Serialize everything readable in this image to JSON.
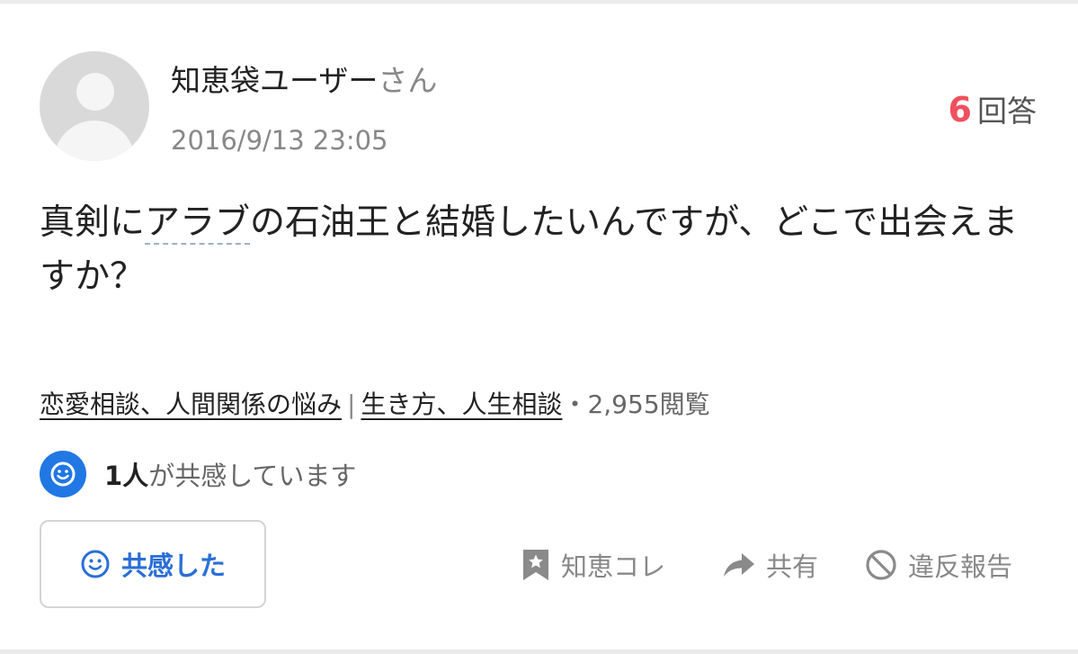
{
  "question": {
    "user_name": "知恵袋ユーザー",
    "user_suffix": "さん",
    "posted_at": "2016/9/13 23:05",
    "answer_count": "6",
    "answer_label": "回答",
    "text_before": "真剣に",
    "text_keyword": "アラブ",
    "text_after": "の石油王と結婚したいんですが、どこで出会えますか？"
  },
  "meta": {
    "category_1": "恋愛相談、人間関係の悩み",
    "separator": "|",
    "category_2": "生き方、人生相談",
    "views": "・2,955閲覧"
  },
  "empathy": {
    "count": "1人",
    "text": "が共感しています",
    "button_label": "共感した"
  },
  "actions": {
    "bookmark_label": "知恵コレ",
    "share_label": "共有",
    "report_label": "違反報告"
  },
  "colors": {
    "accent_blue": "#2177e3",
    "answer_count_red": "#f0505e"
  }
}
